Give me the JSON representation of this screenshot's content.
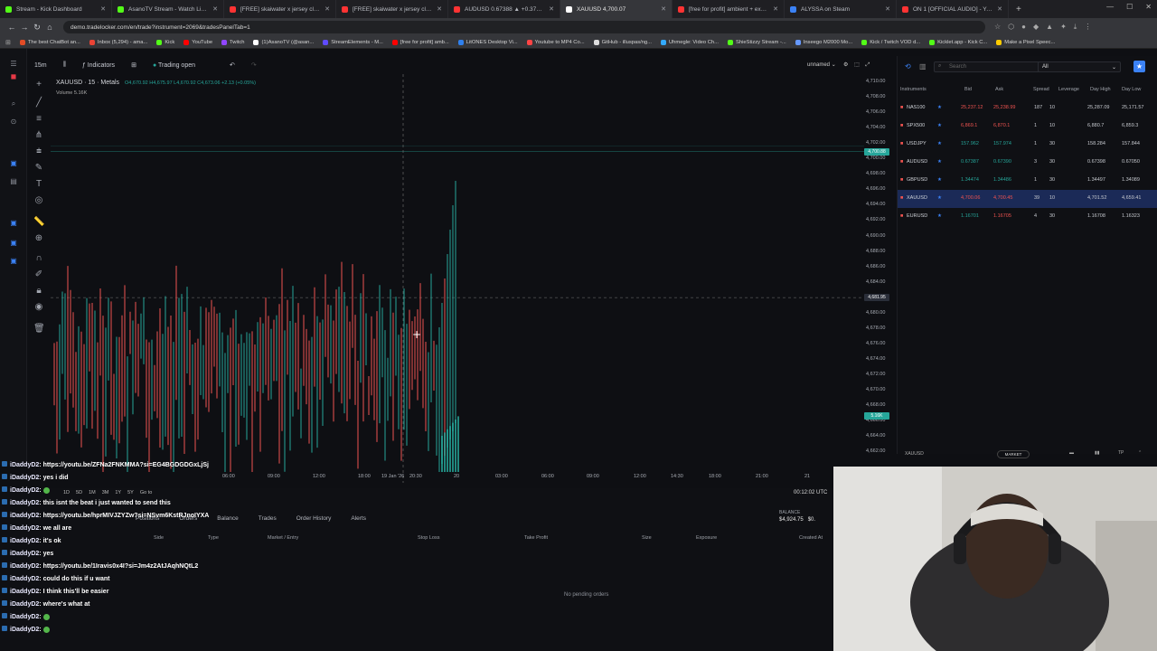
{
  "browser": {
    "tabs": [
      {
        "title": "Stream - Kick Dashboard",
        "color": "#53fc18"
      },
      {
        "title": "AsanoTV Stream - Watch Live on Kick",
        "color": "#53fc18"
      },
      {
        "title": "[FREE] skaiwater x jersey club typ",
        "color": "#ff3333"
      },
      {
        "title": "[FREE] skaiwater x jersey club type b",
        "color": "#ff3333"
      },
      {
        "title": "AUDUSD 0.67388 ▲ +0.37% Buy/Sell",
        "color": "#ff3333"
      },
      {
        "title": "XAUUSD 4,700.07",
        "color": "#ffffff",
        "active": true
      },
      {
        "title": "[free for profit] ambient + experimen",
        "color": "#ff3333"
      },
      {
        "title": "ALYSSA on Steam",
        "color": "#3b82f6"
      },
      {
        "title": "ON 1 [OFFICIAL AUDIO] - YouTube",
        "color": "#ff3333"
      }
    ],
    "url": "demo.tradelocker.com/en/trade?instrument=2069&tradesPanelTab=1",
    "bookmarks": [
      {
        "label": "The best ChatBot an...",
        "color": "#e34c26"
      },
      {
        "label": "Inbox (5,294) - ama...",
        "color": "#ea4335"
      },
      {
        "label": "Kick",
        "color": "#53fc18"
      },
      {
        "label": "YouTube",
        "color": "#ff0000"
      },
      {
        "label": "Twitch",
        "color": "#9146ff"
      },
      {
        "label": "(1)AsanoTV (@asan...",
        "color": "#ffffff"
      },
      {
        "label": "StreamElements - M...",
        "color": "#5f4bff"
      },
      {
        "label": "[free for profit] amb...",
        "color": "#ff0000"
      },
      {
        "label": "LitONES Desktop Vi...",
        "color": "#2f80ed"
      },
      {
        "label": "Youtube to MP4 Co...",
        "color": "#ff4444"
      },
      {
        "label": "GitHub - illuspas/ng...",
        "color": "#dddddd"
      },
      {
        "label": "Uhmegle: Video Ch...",
        "color": "#33aaff"
      },
      {
        "label": "ShieStizzy Stream -...",
        "color": "#53fc18"
      },
      {
        "label": "Inseego M2000 Mo...",
        "color": "#6699ff"
      },
      {
        "label": "Kick / Twitch VOD d...",
        "color": "#53fc18"
      },
      {
        "label": "Kicklet.app - Kick C...",
        "color": "#53fc18"
      },
      {
        "label": "Make a Pixel Speec...",
        "color": "#ffcc00"
      }
    ]
  },
  "toolbar": {
    "timeframe": "15m",
    "indicators": "Indicators",
    "trading": "Trading open",
    "layout_name": "unnamed"
  },
  "legend": {
    "title": "XAUUSD · 15 · Metals",
    "ohlc": "O4,670.92 H4,675.97 L4,670.92 C4,673.06 +2.13 (+0.05%)",
    "volume": "Volume  5.16K"
  },
  "price_axis": {
    "labels": [
      "4,710.00",
      "4,708.00",
      "4,706.00",
      "4,704.00",
      "4,702.00",
      "4,700.00",
      "4,698.00",
      "4,696.00",
      "4,694.00",
      "4,692.00",
      "4,690.00",
      "4,688.00",
      "4,686.00",
      "4,684.00",
      "4,682.00",
      "4,680.00",
      "4,678.00",
      "4,676.00",
      "4,674.00",
      "4,672.00",
      "4,670.00",
      "4,668.00",
      "4,666.00",
      "4,664.00",
      "4,662.00"
    ],
    "last_price": "4,700.88",
    "crosshair_price": "4,681.95",
    "volume_tag": "5.16K"
  },
  "time_axis": {
    "labels": [
      "06:00",
      "09:00",
      "12:00",
      "18:00",
      "19 Jan '26",
      "20:30",
      "20",
      "03:00",
      "06:00",
      "09:00",
      "12:00",
      "14:30",
      "18:00",
      "21:00",
      "21"
    ]
  },
  "instruments": {
    "search_placeholder": "Search",
    "filter": "All",
    "headers": {
      "instr": "Instruments",
      "bid": "Bid",
      "ask": "Ask",
      "spread": "Spread",
      "leverage": "Leverage",
      "dayhigh": "Day High",
      "daylow": "Day Low"
    },
    "rows": [
      {
        "sym": "NAS100",
        "bid": "25,237.12",
        "ask": "25,238.99",
        "spread": "187",
        "lev": "10",
        "dh": "25,287.09",
        "dl": "25,171.57",
        "bidc": "red",
        "askc": "red"
      },
      {
        "sym": "SPX500",
        "bid": "6,869.1",
        "ask": "6,870.1",
        "spread": "1",
        "lev": "10",
        "dh": "6,880.7",
        "dl": "6,859.3",
        "bidc": "red",
        "askc": "red"
      },
      {
        "sym": "USDJPY",
        "bid": "157.962",
        "ask": "157.974",
        "spread": "1",
        "lev": "30",
        "dh": "158.284",
        "dl": "157.844",
        "bidc": "green",
        "askc": "green"
      },
      {
        "sym": "AUDUSD",
        "bid": "0.67387",
        "ask": "0.67390",
        "spread": "3",
        "lev": "30",
        "dh": "0.67398",
        "dl": "0.67050",
        "bidc": "green",
        "askc": "green"
      },
      {
        "sym": "GBPUSD",
        "bid": "1.34474",
        "ask": "1.34486",
        "spread": "1",
        "lev": "30",
        "dh": "1.34497",
        "dl": "1.34089",
        "bidc": "green",
        "askc": "green"
      },
      {
        "sym": "XAUUSD",
        "bid": "4,700.06",
        "ask": "4,700.45",
        "spread": "39",
        "lev": "10",
        "dh": "4,701.52",
        "dl": "4,659.41",
        "bidc": "red",
        "askc": "red",
        "selected": true
      },
      {
        "sym": "EURUSD",
        "bid": "1.16701",
        "ask": "1.16705",
        "spread": "4",
        "lev": "30",
        "dh": "1.16708",
        "dl": "1.16323",
        "bidc": "green",
        "askc": "red"
      }
    ],
    "bottom_symbol": "XAUUSD",
    "market_btn": "MARKET"
  },
  "bottom": {
    "timeframes": [
      "1D",
      "5D",
      "1M",
      "3M",
      "1Y",
      "5Y",
      "Go to"
    ],
    "clock": "00:12:02 UTC",
    "tabs": [
      "Positions",
      "Orders",
      "Balance",
      "Trades",
      "Order History",
      "Alerts"
    ],
    "balance_label": "BALANCE",
    "balance_value": "$4,924.75",
    "pnl_value": "$0.",
    "headers": [
      "Side",
      "Type",
      "Market / Entry",
      "Stop Loss",
      "Take Profit",
      "Size",
      "Exposure",
      "Created At"
    ],
    "empty": "No pending orders"
  },
  "chat": [
    {
      "user": "iDaddyD2",
      "msg": ": https://youtu.be/ZFNa2FNKMMA?si=EG4BGDGDGxLjSj"
    },
    {
      "user": "iDaddyD2",
      "msg": ": yes i did"
    },
    {
      "user": "iDaddyD2",
      "msg": ":",
      "emote": true
    },
    {
      "user": "iDaddyD2",
      "msg": ": this isnt the beat i just wanted to send this"
    },
    {
      "user": "iDaddyD2",
      "msg": ": https://youtu.be/hprMIVJZYZw?si=NSvm6KstRJnoIYXA"
    },
    {
      "user": "iDaddyD2",
      "msg": ": we all are"
    },
    {
      "user": "iDaddyD2",
      "msg": ": it's ok"
    },
    {
      "user": "iDaddyD2",
      "msg": ": yes"
    },
    {
      "user": "iDaddyD2",
      "msg": ": https://youtu.be/1Iravis0x4I?si=Jm4z2AtJAqhNQtL2"
    },
    {
      "user": "iDaddyD2",
      "msg": ": could do this if u want"
    },
    {
      "user": "iDaddyD2",
      "msg": ": I think this'll be easier"
    },
    {
      "user": "iDaddyD2",
      "msg": ": where's what at"
    },
    {
      "user": "iDaddyD2",
      "msg": ":",
      "emote": true
    },
    {
      "user": "iDaddyD2",
      "msg": ":",
      "emote": true
    }
  ]
}
